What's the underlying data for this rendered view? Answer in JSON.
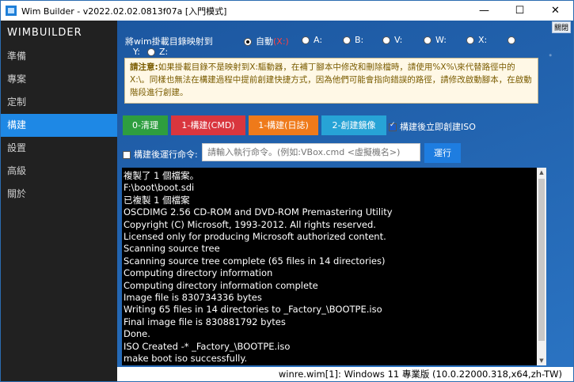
{
  "window": {
    "title": "Wim Builder - v2022.02.02.0813f07a [入門模式]",
    "minimize": "—",
    "maximize": "☐",
    "close": "✕"
  },
  "sidebar": {
    "brand": "WIMBUILDER",
    "items": [
      "準備",
      "專案",
      "定制",
      "構建",
      "設置",
      "高級",
      "關於"
    ],
    "active": "構建"
  },
  "main": {
    "about": "關閉",
    "drive_label": "將wim掛載目錄映射到",
    "drive_options": [
      "自動",
      "A:",
      "B:",
      "V:",
      "W:",
      "X:",
      "",
      "Y:",
      "Z:"
    ],
    "auto_suffix": "(X:)",
    "notice_title": "請注意:",
    "notice_text": "如果掛載目錄不是映射到X:驅動器，在補丁腳本中修改和刪除檔時，請使用%X%\\來代替路徑中的X:\\。同樣也無法在構建過程中提前創建快捷方式，因為他們可能會指向錯誤的路徑，請修改啟動腳本，在啟動階段進行創建。",
    "buttons": {
      "clean": "0-清理",
      "build_cmd": "1-構建(CMD)",
      "build_log": "1-構建(日誌)",
      "create_iso": "2-創建鏡像"
    },
    "create_iso_after": "構建後立即創建ISO",
    "run_after_label": "構建後運行命令:",
    "command_placeholder": "請輸入執行命令。(例如:VBox.cmd <虛擬機名>)",
    "run_button": "運行"
  },
  "console_lines": [
    "複製了 1 個檔案。",
    "F:\\boot\\boot.sdi",
    "已複製 1 個檔案",
    "OSCDIMG 2.56 CD-ROM and DVD-ROM Premastering Utility",
    "Copyright (C) Microsoft, 1993-2012. All rights reserved.",
    "Licensed only for producing Microsoft authorized content.",
    "Scanning source tree",
    "Scanning source tree complete (65 files in 14 directories)",
    "Computing directory information",
    "Computing directory information complete",
    "Image file is 830734336 bytes",
    "Writing 65 files in 14 directories to _Factory_\\BOOTPE.iso",
    "Final image file is 830881792 bytes",
    "Done.",
    "ISO Created -* _Factory_\\BOOTPE.iso",
    "make boot iso successfully."
  ],
  "status": "winre.wim[1]: Windows 11 專業版 (10.0.22000.318,x64,zh-TW)",
  "colors": {
    "sidebar_bg": "#212121",
    "active_bg": "#1e88e5",
    "main_bg": "#1f5fa8"
  }
}
